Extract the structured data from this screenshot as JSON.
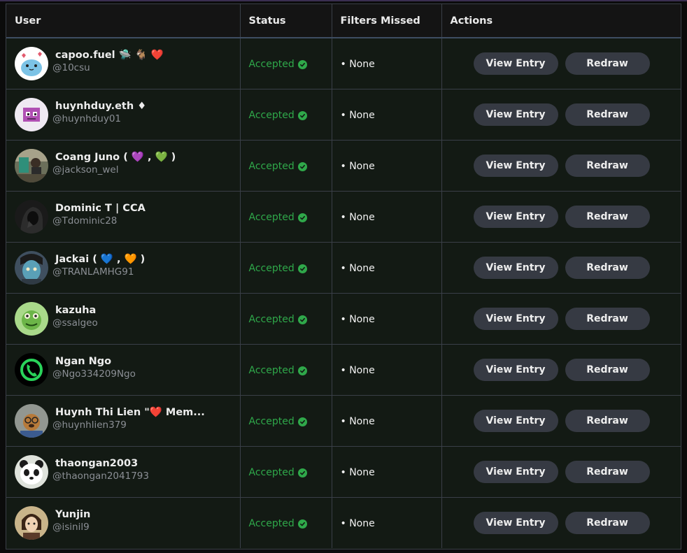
{
  "table": {
    "headers": [
      "User",
      "Status",
      "Filters Missed",
      "Actions"
    ],
    "rows": [
      {
        "name": "capoo.fuel 🛸 🐐 ❤️",
        "handle": "@10csu",
        "avatar": "capoo-cat-avatar",
        "status": "Accepted",
        "filters": "• None",
        "view_label": "View Entry",
        "redraw_label": "Redraw"
      },
      {
        "name": "huynhduy.eth ♦",
        "handle": "@huynhduy01",
        "avatar": "pixel-robot-avatar",
        "status": "Accepted",
        "filters": "• None",
        "view_label": "View Entry",
        "redraw_label": "Redraw"
      },
      {
        "name": "Coang Juno ( 💜 , 💚 )",
        "handle": "@jackson_wel",
        "avatar": "photo-avatar",
        "status": "Accepted",
        "filters": "• None",
        "view_label": "View Entry",
        "redraw_label": "Redraw"
      },
      {
        "name": "Dominic T | CCA",
        "handle": "@Tdominic28",
        "avatar": "hooded-figure-avatar",
        "status": "Accepted",
        "filters": "• None",
        "view_label": "View Entry",
        "redraw_label": "Redraw"
      },
      {
        "name": "Jackai ( 💙 , 🧡 )",
        "handle": "@TRANLAMHG91",
        "avatar": "blue-face-avatar",
        "status": "Accepted",
        "filters": "• None",
        "view_label": "View Entry",
        "redraw_label": "Redraw"
      },
      {
        "name": "kazuha",
        "handle": "@ssalgeo",
        "avatar": "green-frog-avatar",
        "status": "Accepted",
        "filters": "• None",
        "view_label": "View Entry",
        "redraw_label": "Redraw"
      },
      {
        "name": "Ngan Ngo",
        "handle": "@Ngo334209Ngo",
        "avatar": "green-phone-avatar",
        "status": "Accepted",
        "filters": "• None",
        "view_label": "View Entry",
        "redraw_label": "Redraw"
      },
      {
        "name": "Huynh Thi Lien \"❤️ Mem...",
        "handle": "@huynhlien379",
        "avatar": "cartoon-dog-avatar",
        "status": "Accepted",
        "filters": "• None",
        "view_label": "View Entry",
        "redraw_label": "Redraw"
      },
      {
        "name": "thaongan2003",
        "handle": "@thaongan2041793",
        "avatar": "panda-avatar",
        "status": "Accepted",
        "filters": "• None",
        "view_label": "View Entry",
        "redraw_label": "Redraw"
      },
      {
        "name": "Yunjin",
        "handle": "@isinil9",
        "avatar": "anime-character-avatar",
        "status": "Accepted",
        "filters": "• None",
        "view_label": "View Entry",
        "redraw_label": "Redraw"
      }
    ]
  },
  "colors": {
    "accepted": "#2fa84a",
    "button_bg": "#363a43",
    "row_bg": "#131a14",
    "header_bg": "#141414"
  }
}
